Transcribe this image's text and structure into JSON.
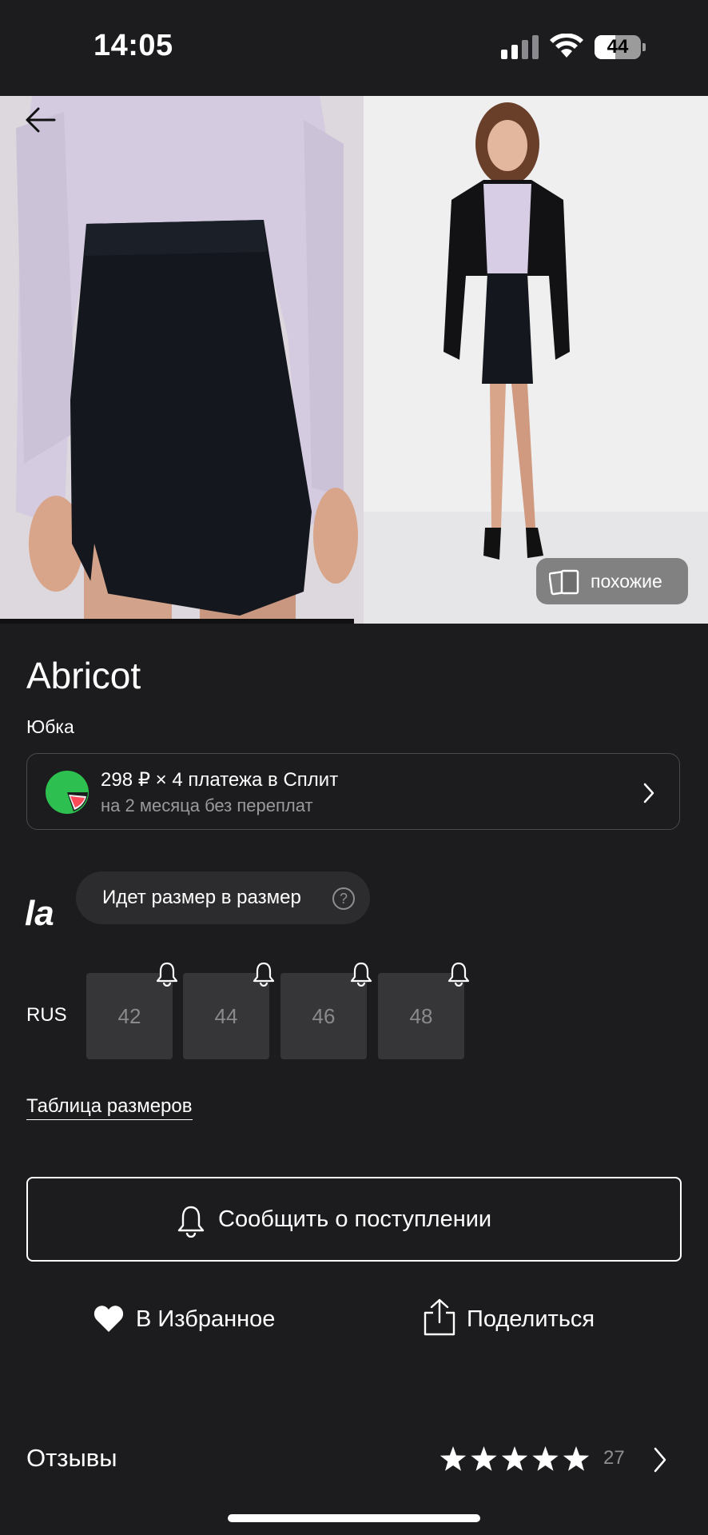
{
  "status_bar": {
    "time": "14:05",
    "battery": "44",
    "battery_level": 0.44
  },
  "gallery": {
    "similar_label": "похожие",
    "current_index": 1,
    "total": 2
  },
  "product": {
    "brand": "Abricot",
    "category": "Юбка",
    "split": {
      "title": "298 ₽ × 4 платежа в Сплит",
      "subtitle": "на 2 месяца без переплат"
    }
  },
  "fit": {
    "logo": "la",
    "hint": "Идет размер в размер",
    "help": "?"
  },
  "sizes": {
    "system": "RUS",
    "options": [
      {
        "label": "42",
        "available": false
      },
      {
        "label": "44",
        "available": false
      },
      {
        "label": "46",
        "available": false
      },
      {
        "label": "48",
        "available": false
      }
    ],
    "table_link": "Таблица размеров"
  },
  "actions": {
    "notify": "Сообщить о поступлении",
    "favorite": "В Избранное",
    "share": "Поделиться"
  },
  "reviews": {
    "label": "Отзывы",
    "rating": 5,
    "count": "27"
  },
  "colors": {
    "background": "#1c1c1e",
    "size_tile": "#363638",
    "split_green": "#2dbf4f"
  }
}
